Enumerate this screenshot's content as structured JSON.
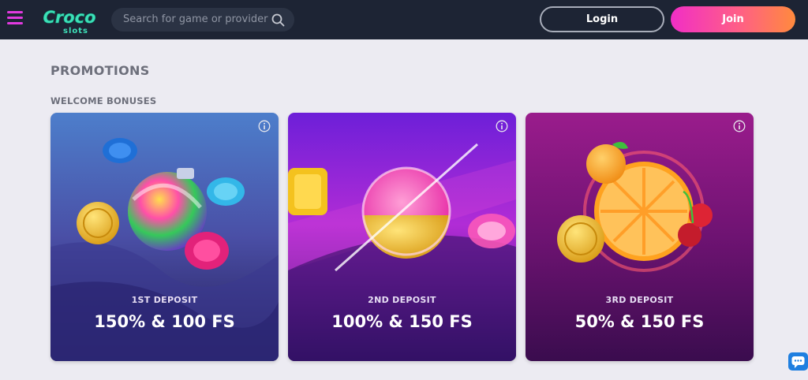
{
  "header": {
    "logo_text": "Croco",
    "logo_sub": "slots",
    "search_placeholder": "Search for game or provider",
    "login_label": "Login",
    "join_label": "Join"
  },
  "page": {
    "title": "PROMOTIONS",
    "section_title": "WELCOME BONUSES"
  },
  "promotions": [
    {
      "deposit": "1ST DEPOSIT",
      "bonus": "150% & 100 FS"
    },
    {
      "deposit": "2ND DEPOSIT",
      "bonus": "100% & 150 FS"
    },
    {
      "deposit": "3RD DEPOSIT",
      "bonus": "50% & 150 FS"
    }
  ],
  "colors": {
    "header_bg": "#1d2434",
    "accent_pink": "#e23ae0",
    "join_gradient": [
      "#f12ec6",
      "#ff8a3d"
    ],
    "page_bg": "#ecebf2"
  },
  "icons": [
    "menu-icon",
    "search-icon",
    "info-icon",
    "chat-icon"
  ]
}
